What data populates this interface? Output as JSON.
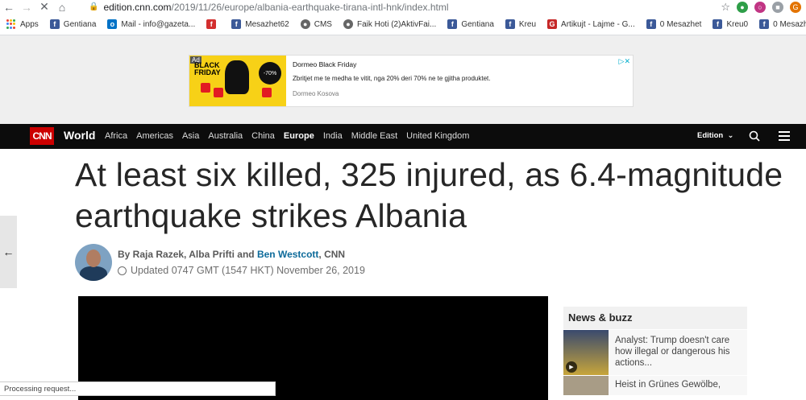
{
  "browser": {
    "url_host": "edition.cnn.com",
    "url_path": "/2019/11/26/europe/albania-earthquake-tirana-intl-hnk/index.html",
    "profile_initial": "G"
  },
  "bookmarks": [
    {
      "label": "Apps",
      "icon": "apps-grid-icon"
    },
    {
      "label": "Gentiana",
      "icon": "facebook-icon"
    },
    {
      "label": "Mail - info@gazeta...",
      "icon": "outlook-icon"
    },
    {
      "label": "",
      "icon": "f-red-icon"
    },
    {
      "label": "Mesazhet62",
      "icon": "facebook-icon"
    },
    {
      "label": "CMS",
      "icon": "globe-icon"
    },
    {
      "label": "Faik Hoti (2)AktivFai...",
      "icon": "globe-icon"
    },
    {
      "label": "Gentiana",
      "icon": "facebook-icon"
    },
    {
      "label": "Kreu",
      "icon": "facebook-icon"
    },
    {
      "label": "Artikujt - Lajme - G...",
      "icon": "ge-icon"
    },
    {
      "label": "0 Mesazhet",
      "icon": "facebook-icon"
    },
    {
      "label": "Kreu0",
      "icon": "facebook-icon"
    },
    {
      "label": "0 Mesazhet",
      "icon": "facebook-icon"
    }
  ],
  "ad": {
    "tag": "Ad",
    "image_title_1": "BLACK",
    "image_title_2": "FRIDAY",
    "badge": "-70%",
    "title": "Dormeo Black Friday",
    "description": "Zbritjet me te medha te vitit, nga 20% deri 70% ne te gjitha produktet.",
    "brand": "Dormeo Kosova"
  },
  "cnn_nav": {
    "logo": "CNN",
    "section": "World",
    "links": [
      "Africa",
      "Americas",
      "Asia",
      "Australia",
      "China",
      "Europe",
      "India",
      "Middle East",
      "United Kingdom"
    ],
    "active_link": "Europe",
    "edition": "Edition"
  },
  "article": {
    "headline": "At least six killed, 325 injured, as 6.4-magnitude earthquake strikes Albania",
    "byline_prefix": "By Raja Razek, Alba Prifti and",
    "byline_link": "Ben Westcott",
    "byline_suffix": ", CNN",
    "updated": "Updated 0747 GMT (1547 HKT) November 26, 2019"
  },
  "news_buzz": {
    "title": "News & buzz",
    "items": [
      {
        "text": "Analyst: Trump doesn't care how illegal or dangerous his actions..."
      },
      {
        "text": "Heist in Grünes Gewölbe,"
      }
    ]
  },
  "status_text": "Processing request..."
}
